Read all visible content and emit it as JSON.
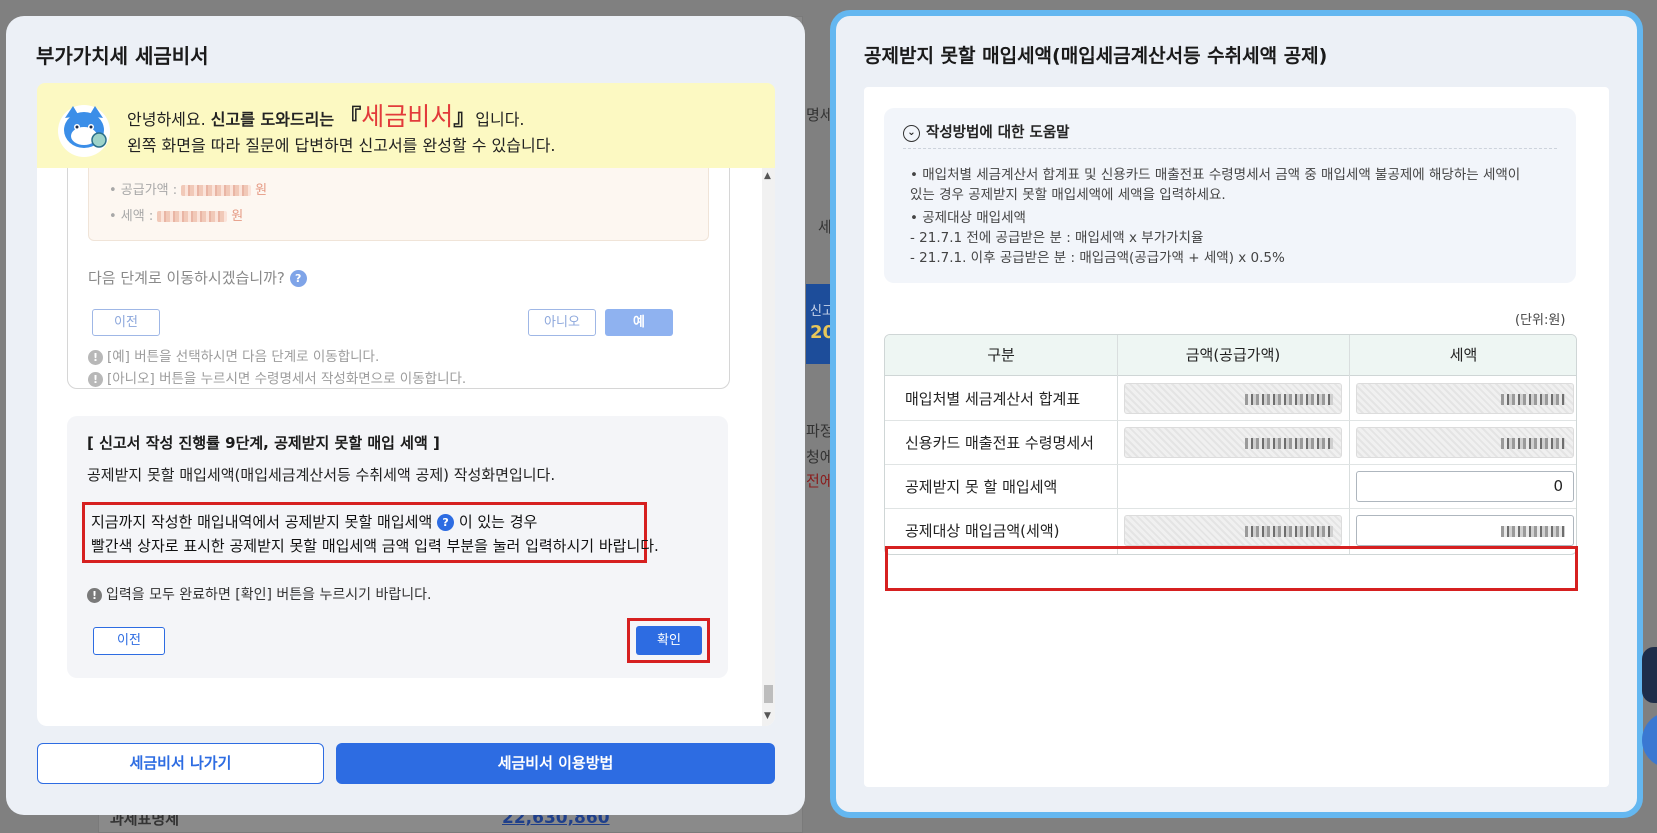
{
  "background": {
    "fragments": [
      "명세",
      "세",
      "신고",
      "20",
      "파정",
      "청에서",
      "전에",
      "과세표명세"
    ],
    "amount": "22,630,860"
  },
  "left_modal": {
    "title": "부가가치세 세금비서",
    "greeting": {
      "line1_prefix": "안녕하세요. ",
      "line1_bold": "신고를 도와드리는",
      "brand_open": "『",
      "brand": "세금비서",
      "brand_close": "』",
      "line1_suffix": "입니다.",
      "line2": "왼쪽 화면을 따라 질문에 답변하면 신고서를 완성할 수 있습니다."
    },
    "previous_step": {
      "supply_label": "• 공급가액 :",
      "tax_label": "• 세액 :",
      "won": "원",
      "question": "다음 단계로 이동하시겠습니까?",
      "help_mark": "?",
      "prev_button": "이전",
      "no_button": "아니오",
      "yes_button": "예",
      "note1": "[예] 버튼을 선택하시면 다음 단계로 이동합니다.",
      "note2": "[아니오] 버튼을 누르시면 수령명세서 작성화면으로 이동합니다.",
      "warn_mark": "!"
    },
    "current_step": {
      "title": "[ 신고서 작성 진행률 9단계, 공제받지 못할 매입 세액 ]",
      "description": "공제받지 못할 매입세액(매입세금계산서등 수취세액 공제) 작성화면입니다.",
      "highlight_line1_prefix": "지금까지 작성한 매입내역에서 공제받지 못할 매입세액",
      "help_mark": "?",
      "highlight_line1_suffix": "이 있는 경우",
      "highlight_line2": "빨간색 상자로 표시한 공제받지 못할 매입세액 금액 입력 부분을 눌러 입력하시기 바랍니다.",
      "note": "입력을 모두 완료하면 [확인] 버튼을 누르시기 바랍니다.",
      "warn_mark": "!",
      "prev_button": "이전",
      "confirm_button": "확인"
    },
    "footer": {
      "exit_button": "세금비서 나가기",
      "guide_button": "세금비서 이용방법"
    },
    "scrollbar": {
      "up": "▲",
      "down": "▼"
    }
  },
  "right_modal": {
    "title": "공제받지 못할 매입세액(매입세금계산서등 수취세액 공제)",
    "help": {
      "heading": "작성방법에 대한 도움말",
      "chevron": "⌄",
      "lines": [
        "• 매입처별 세금계산서 합계표 및 신용카드 매출전표 수령명세서 금액 중 매입세액 불공제에 해당하는 세액이",
        "  있는 경우 공제받지 못할 매입세액에 세액을 입력하세요.",
        "• 공제대상 매입세액",
        "  - 21.7.1 전에 공급받은 분 : 매입세액 x 부가가치율",
        "  - 21.7.1. 이후 공급받은 분 : 매입금액(공급가액 + 세액) x 0.5%"
      ]
    },
    "unit": "(단위:원)",
    "table": {
      "headers": [
        "구분",
        "금액(공급가액)",
        "세액"
      ],
      "rows": [
        {
          "label": "매입처별 세금계산서 합계표"
        },
        {
          "label": "신용카드 매출전표 수령명세서"
        },
        {
          "label": "공제받지 못 할 매입세액",
          "tax_value": "0"
        },
        {
          "label": "공제대상 매입금액(세액)"
        }
      ]
    }
  },
  "colors": {
    "primary": "#2d6ce2",
    "highlight_red": "#d62020",
    "brand_red": "#e23b3b",
    "active_border": "#64b7f0",
    "greeting_bg": "#fcf9c2"
  }
}
